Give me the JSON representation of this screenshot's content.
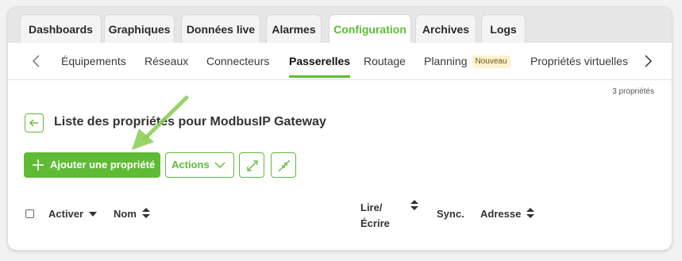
{
  "tabs": [
    {
      "label": "Dashboards"
    },
    {
      "label": "Graphiques"
    },
    {
      "label": "Données live"
    },
    {
      "label": "Alarmes"
    },
    {
      "label": "Configuration",
      "active": true
    },
    {
      "label": "Archives"
    },
    {
      "label": "Logs"
    }
  ],
  "subnav": {
    "items": [
      {
        "label": "Équipements"
      },
      {
        "label": "Réseaux"
      },
      {
        "label": "Connecteurs"
      },
      {
        "label": "Passerelles",
        "active": true
      },
      {
        "label": "Routage"
      },
      {
        "label": "Planning",
        "badge": "Nouveau"
      },
      {
        "label": "Propriétés virtuelles"
      }
    ]
  },
  "main": {
    "count_label": "3 propriétés",
    "title": "Liste des propriétés pour ModbusIP Gateway",
    "add_button": "Ajouter une propriété",
    "actions_button": "Actions"
  },
  "table": {
    "columns": {
      "activer": "Activer",
      "nom": "Nom",
      "lire_ecrire_line1": "Lire/",
      "lire_ecrire_line2": "Écrire",
      "sync": "Sync.",
      "adresse": "Adresse"
    }
  },
  "colors": {
    "accent": "#5fbb35",
    "badge_bg": "#fdf3cf",
    "pointer_arrow": "#8ecf5a"
  }
}
